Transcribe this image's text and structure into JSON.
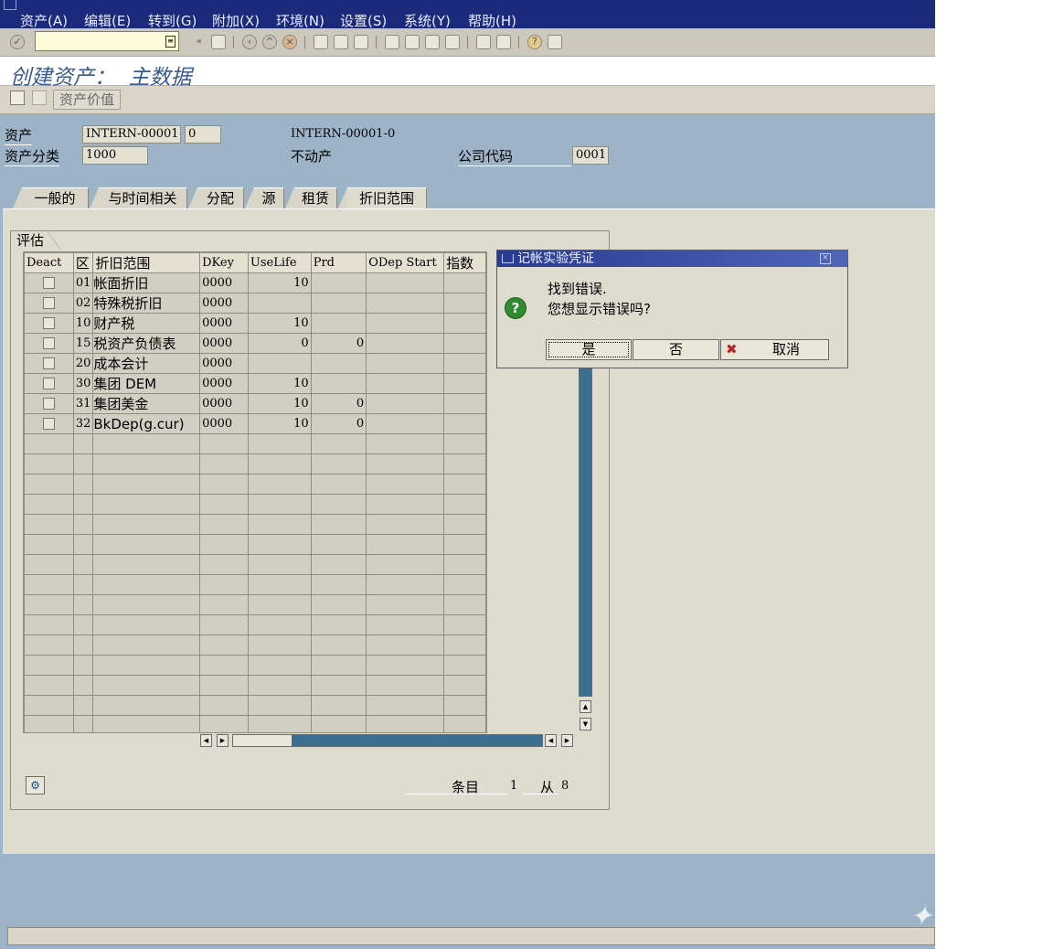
{
  "menu": {
    "items": [
      "资产(A)",
      "编辑(E)",
      "转到(G)",
      "附加(X)",
      "环境(N)",
      "设置(S)",
      "系统(Y)",
      "帮助(H)"
    ]
  },
  "toolbar": {
    "command_value": ""
  },
  "title": {
    "text": "创建资产：  主数据"
  },
  "app_toolbar": {
    "asset_value_label": "资产价值"
  },
  "header": {
    "asset_label": "资产",
    "asset_number": "INTERN-00001",
    "asset_sub": "0",
    "asset_full": "INTERN-00001-0",
    "class_label": "资产分类",
    "class_value": "1000",
    "class_desc": "不动产",
    "company_label": "公司代码",
    "company_value": "0001"
  },
  "tabs": [
    "一般的",
    "与时间相关",
    "分配",
    "源",
    "租赁",
    "折旧范围"
  ],
  "active_tab": "折旧范围",
  "group": {
    "title": "评估"
  },
  "table": {
    "columns": [
      "Deact",
      "区",
      "折旧范围",
      "DKey",
      "UseLife",
      "Prd",
      "ODep Start",
      "指数"
    ],
    "rows": [
      {
        "area": "01",
        "name": "帐面折旧",
        "dkey": "0000",
        "uselife": "10",
        "prd": "",
        "odep": "",
        "index": ""
      },
      {
        "area": "02",
        "name": "特殊税折旧",
        "dkey": "0000",
        "uselife": "",
        "prd": "",
        "odep": "",
        "index": ""
      },
      {
        "area": "10",
        "name": "财产税",
        "dkey": "0000",
        "uselife": "10",
        "prd": "",
        "odep": "",
        "index": ""
      },
      {
        "area": "15",
        "name": "税资产负债表",
        "dkey": "0000",
        "uselife": "0",
        "prd": "0",
        "odep": "",
        "index": ""
      },
      {
        "area": "20",
        "name": "成本会计",
        "dkey": "0000",
        "uselife": "",
        "prd": "",
        "odep": "",
        "index": ""
      },
      {
        "area": "30",
        "name": "集团 DEM",
        "dkey": "0000",
        "uselife": "10",
        "prd": "",
        "odep": "",
        "index": ""
      },
      {
        "area": "31",
        "name": "集团美金",
        "dkey": "0000",
        "uselife": "10",
        "prd": "0",
        "odep": "",
        "index": ""
      },
      {
        "area": "32",
        "name": "BkDep(g.cur)",
        "dkey": "0000",
        "uselife": "10",
        "prd": "0",
        "odep": "",
        "index": ""
      }
    ],
    "empty_rows": 15
  },
  "footer": {
    "entry_label": "条目",
    "entry_value": "1",
    "of_label": "从",
    "of_value": "8"
  },
  "dialog": {
    "title": "记帐实验凭证",
    "line1": "找到错误.",
    "line2": "您想显示错误吗?",
    "yes": "是",
    "no": "否",
    "cancel": "取消"
  }
}
